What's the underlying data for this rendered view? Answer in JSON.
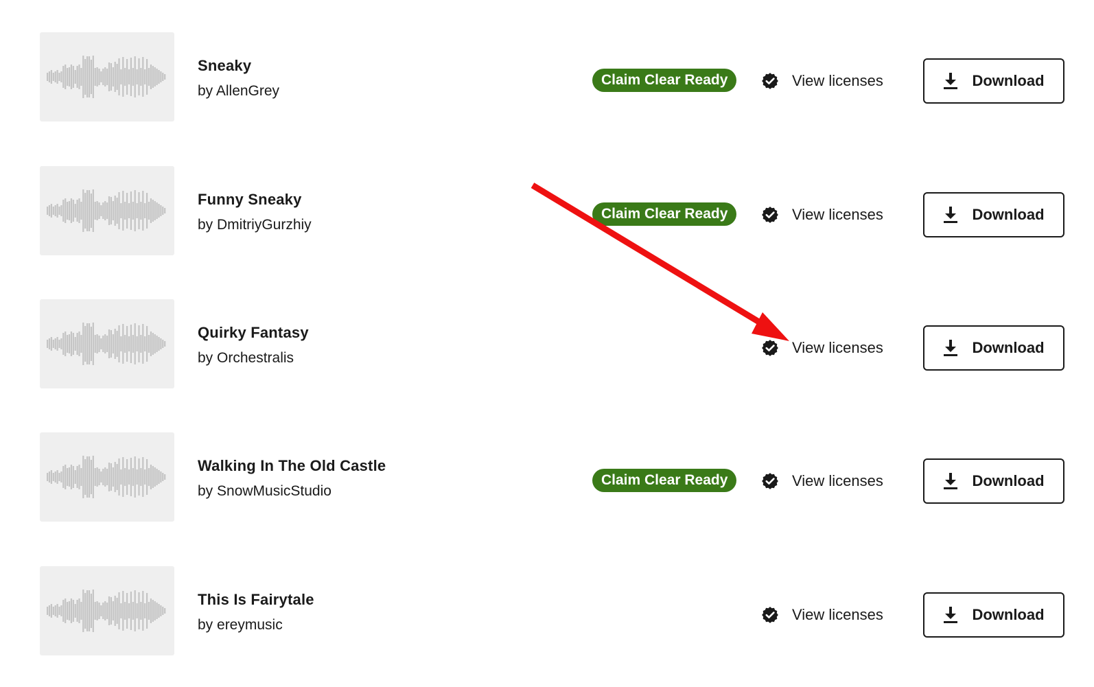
{
  "tracks": [
    {
      "title": "Sneaky",
      "artist": "by AllenGrey",
      "badge": "Claim Clear Ready",
      "licenses_label": "View licenses",
      "download_label": "Download"
    },
    {
      "title": "Funny Sneaky",
      "artist": "by DmitriyGurzhiy",
      "badge": "Claim Clear Ready",
      "licenses_label": "View licenses",
      "download_label": "Download"
    },
    {
      "title": "Quirky Fantasy",
      "artist": "by Orchestralis",
      "badge": "",
      "licenses_label": "View licenses",
      "download_label": "Download"
    },
    {
      "title": "Walking In The Old Castle",
      "artist": "by SnowMusicStudio",
      "badge": "Claim Clear Ready",
      "licenses_label": "View licenses",
      "download_label": "Download"
    },
    {
      "title": "This Is Fairytale",
      "artist": "by ereymusic",
      "badge": "",
      "licenses_label": "View licenses",
      "download_label": "Download"
    }
  ],
  "colors": {
    "badge_bg": "#3a7a18",
    "annotation": "#ee1111",
    "waveform": "#c4c4c4"
  },
  "icons": {
    "thumbnail": "waveform-icon",
    "license": "verified-check-icon",
    "download": "download-arrow-icon"
  }
}
